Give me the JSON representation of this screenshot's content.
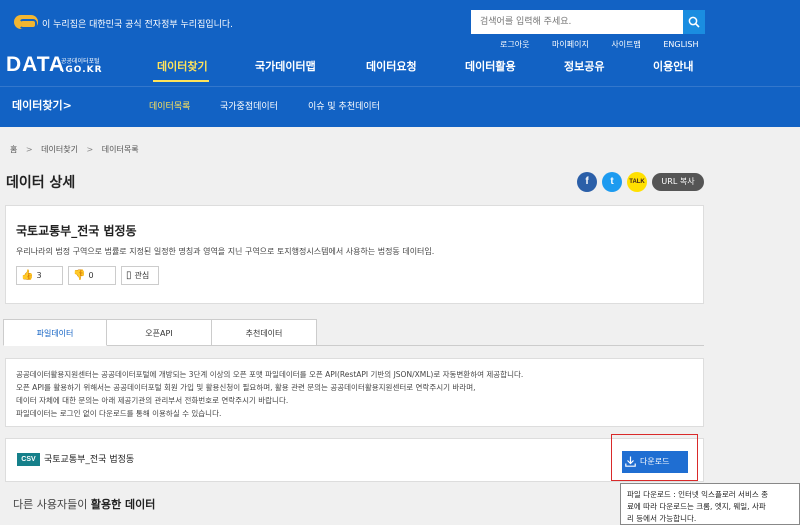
{
  "gov_notice": "이 누리집은 대한민국 공식 전자정부 누리집입니다.",
  "search": {
    "placeholder": "검색어를 입력해 주세요."
  },
  "util_links": [
    "로그아웃",
    "마이페이지",
    "사이트맵",
    "ENGLISH"
  ],
  "logo": {
    "main": "DATA",
    "sub_top": "공공데이터포털",
    "sub_bottom": ".GO.KR"
  },
  "main_nav": [
    "데이터찾기",
    "국가데이터맵",
    "데이터요청",
    "데이터활용",
    "정보공유",
    "이용안내"
  ],
  "section_title": "데이터찾기",
  "section_arrow": ">",
  "sub_nav": [
    "데이터목록",
    "국가중점데이터",
    "이슈 및 추천데이터"
  ],
  "breadcrumb": [
    "홈",
    "데이터찾기",
    "데이터목록"
  ],
  "breadcrumb_sep": ">",
  "page_title": "데이터 상세",
  "share": {
    "facebook": "f",
    "twitter": "t",
    "kakao": "TALK",
    "url_copy": "URL 복사"
  },
  "dataset": {
    "title": "국토교통부_전국 법정동",
    "description": "우리나라의 법정 구역으로 법률로 지정된 일정한 명칭과 영역을 지닌 구역으로 토지행정시스템에서 사용하는 법정동 데이터임.",
    "likes": "3",
    "dislikes": "0",
    "favorite_label": "관심"
  },
  "tabs": [
    "파일데이터",
    "오픈API",
    "추천데이터"
  ],
  "info_lines": [
    "공공데이터활용지원센터는 공공데이터포털에 개방되는 3단계 이상의 오픈 포맷 파일데이터를 오픈 API(RestAPI 기반의 JSON/XML)로 자동변환하여 제공합니다.",
    "오픈 API를 활용하기 위해서는 공공데이터포털 회원 가입 및 활용신청이 필요하며, 활용 관련 문의는 공공데이터활용지원센터로 연락주시기 바라며,",
    "데이터 자체에 대한 문의는 아래 제공기관의 관리부서 전화번호로 연락주시기 바랍니다.",
    "파일데이터는 로그인 없이 다운로드를 통해 이용하실 수 있습니다."
  ],
  "file": {
    "format": "CSV",
    "name": "국토교통부_전국 법정동",
    "download_label": "다운로드"
  },
  "tooltip_lines": [
    "파일 다운로드 : 인터넷 익스플로러 서비스 종",
    "료에 따라 다운로드는 크롬, 엣지, 웨일, 사파",
    "리 등에서 가능합니다."
  ],
  "related": {
    "prefix": "다른 사용자들이 ",
    "emphasis": "활용한 데이터"
  },
  "colors": {
    "header_blue": "#1262c4",
    "nav_active": "#ffe35a",
    "download_blue": "#1f6ed2",
    "csv_teal": "#15808a",
    "highlight_red": "#d92a2a"
  }
}
